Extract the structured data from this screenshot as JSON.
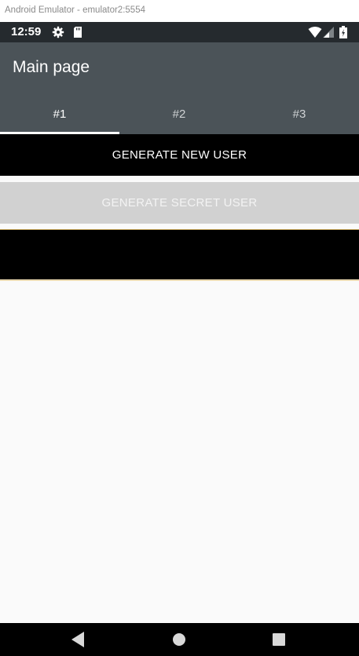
{
  "window": {
    "title": "Android Emulator - emulator2:5554"
  },
  "status_bar": {
    "time": "12:59",
    "icons": [
      "settings-gear-icon",
      "sd-card-icon",
      "wifi-icon",
      "cell-signal-icon",
      "battery-icon"
    ]
  },
  "app_bar": {
    "title": "Main page",
    "tabs": [
      {
        "label": "#1",
        "selected": true
      },
      {
        "label": "#2",
        "selected": false
      },
      {
        "label": "#3",
        "selected": false
      }
    ]
  },
  "main": {
    "generate_new_user_label": "GENERATE NEW USER",
    "generate_secret_user_label": "GENERATE SECRET USER",
    "generate_secret_user_enabled": false
  },
  "nav_bar": {
    "icons": [
      "back-icon",
      "home-icon",
      "recents-icon"
    ]
  },
  "colors": {
    "status_bar": "#252a2e",
    "app_bar": "#4b5358",
    "primary_button": "#000000",
    "disabled_button": "#d1d1d1",
    "content_background": "#fafafa"
  }
}
